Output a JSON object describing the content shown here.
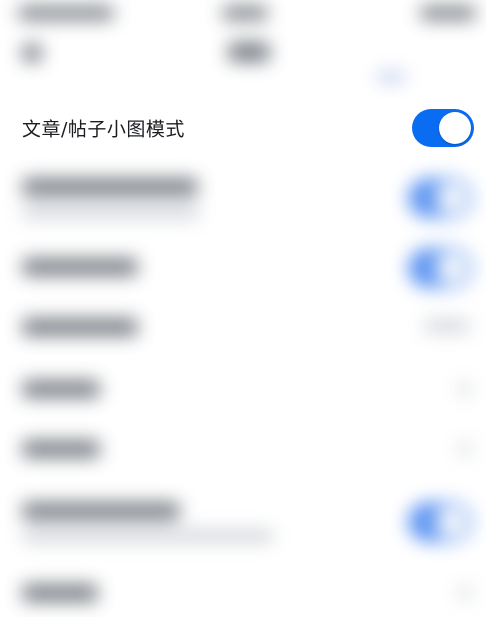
{
  "settings": {
    "focused_item": {
      "label": "文章/帖子小图模式",
      "toggle_on": true
    }
  },
  "colors": {
    "accent": "#0a6cf0",
    "text": "#1b1d22",
    "background": "#ffffff"
  }
}
